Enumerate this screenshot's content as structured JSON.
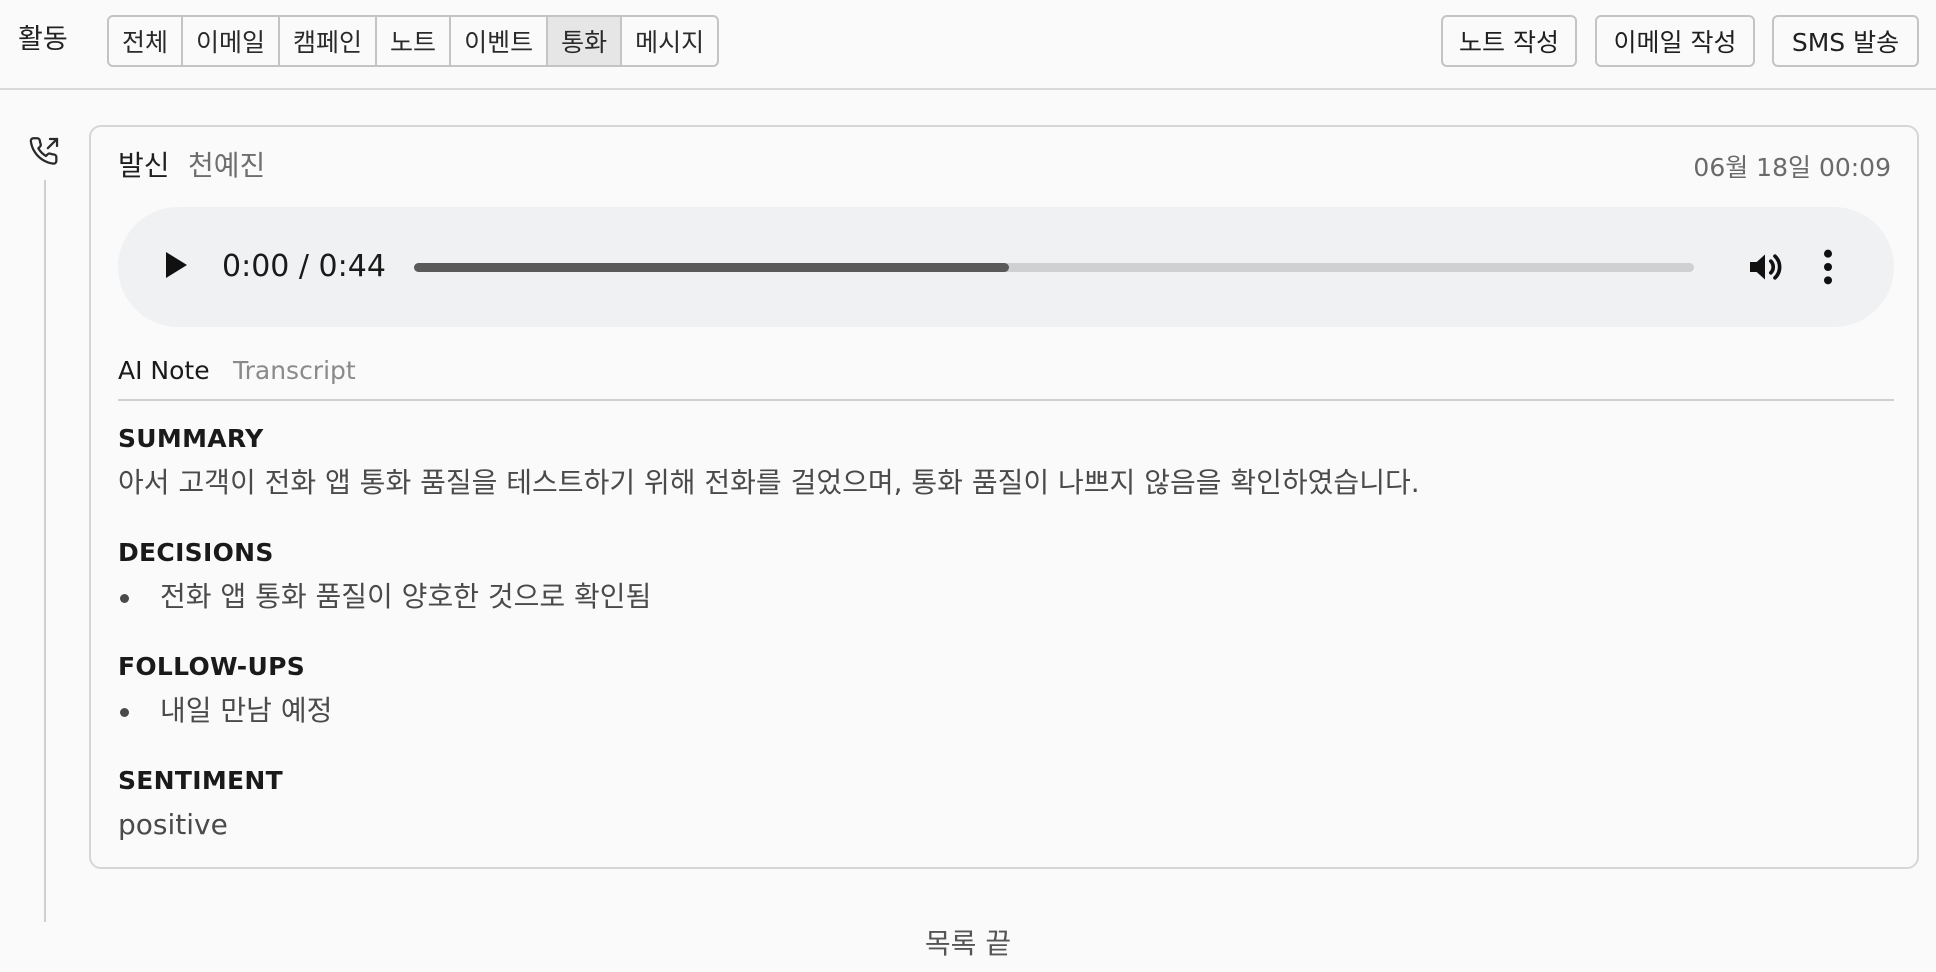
{
  "header": {
    "title": "활동",
    "filters": [
      {
        "label": "전체",
        "active": false
      },
      {
        "label": "이메일",
        "active": false
      },
      {
        "label": "캠페인",
        "active": false
      },
      {
        "label": "노트",
        "active": false
      },
      {
        "label": "이벤트",
        "active": false
      },
      {
        "label": "통화",
        "active": true
      },
      {
        "label": "메시지",
        "active": false
      }
    ],
    "actions": {
      "write_note": "노트 작성",
      "write_email": "이메일 작성",
      "send_sms": "SMS 발송"
    }
  },
  "activity": {
    "icon": "phone-outgoing-icon",
    "direction": "발신",
    "contact": "천예진",
    "timestamp": "06월 18일 00:09",
    "player": {
      "time": "0:00 / 0:44",
      "progress": 0.465
    },
    "tabs": {
      "ai_note": "AI Note",
      "transcript": "Transcript"
    },
    "note": {
      "summary_heading": "SUMMARY",
      "summary_text": "아서 고객이 전화 앱 통화 품질을 테스트하기 위해 전화를 걸었으며, 통화 품질이 나쁘지 않음을 확인하였습니다.",
      "decisions_heading": "DECISIONS",
      "decisions": [
        "전화 앱 통화 품질이 양호한 것으로 확인됨"
      ],
      "followups_heading": "FOLLOW-UPS",
      "followups": [
        "내일 만남 예정"
      ],
      "sentiment_heading": "SENTIMENT",
      "sentiment": "positive"
    }
  },
  "footer": {
    "end_text": "목록 끝"
  }
}
